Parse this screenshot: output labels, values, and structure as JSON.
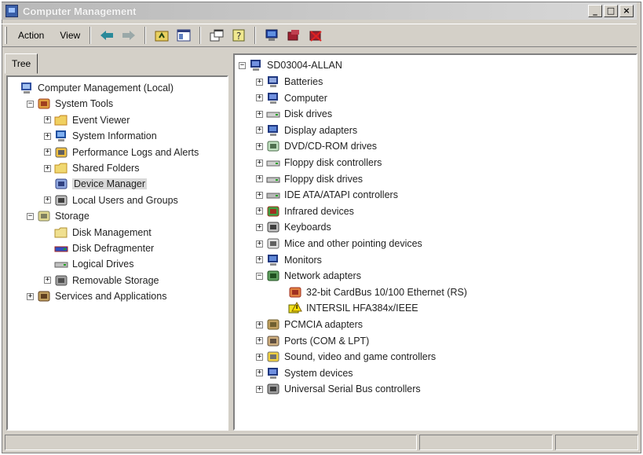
{
  "window": {
    "title": "Computer Management",
    "controls": [
      "_",
      "□",
      "×"
    ]
  },
  "toolbar": {
    "action_label": "Action",
    "view_label": "View"
  },
  "tabs": [
    {
      "label": "Tree"
    }
  ],
  "left_tree": [
    {
      "label": "Computer Management (Local)",
      "icon": "computer-management-icon",
      "expander": "",
      "selected": false
    },
    {
      "label": "System Tools",
      "icon": "system-tools-icon",
      "expander": "−",
      "selected": false
    },
    {
      "label": "Event Viewer",
      "icon": "event-viewer-icon",
      "expander": "+",
      "selected": false
    },
    {
      "label": "System Information",
      "icon": "system-information-icon",
      "expander": "+",
      "selected": false
    },
    {
      "label": "Performance Logs and Alerts",
      "icon": "performance-logs-icon",
      "expander": "+",
      "selected": false
    },
    {
      "label": "Shared Folders",
      "icon": "shared-folders-icon",
      "expander": "+",
      "selected": false
    },
    {
      "label": "Device Manager",
      "icon": "device-manager-icon",
      "expander": "",
      "selected": true
    },
    {
      "label": "Local Users and Groups",
      "icon": "local-users-icon",
      "expander": "+",
      "selected": false
    },
    {
      "label": "Storage",
      "icon": "storage-icon",
      "expander": "−",
      "selected": false
    },
    {
      "label": "Disk Management",
      "icon": "disk-management-icon",
      "expander": "",
      "selected": false
    },
    {
      "label": "Disk Defragmenter",
      "icon": "disk-defragmenter-icon",
      "expander": "",
      "selected": false
    },
    {
      "label": "Logical Drives",
      "icon": "logical-drives-icon",
      "expander": "",
      "selected": false
    },
    {
      "label": "Removable Storage",
      "icon": "removable-storage-icon",
      "expander": "+",
      "selected": false
    },
    {
      "label": "Services and Applications",
      "icon": "services-applications-icon",
      "expander": "+",
      "selected": false
    }
  ],
  "device_tree": {
    "root": {
      "label": "SD03004-ALLAN",
      "icon": "computer-icon"
    },
    "items": [
      {
        "label": "Batteries",
        "icon": "battery-icon",
        "expander": "+"
      },
      {
        "label": "Computer",
        "icon": "computer-icon",
        "expander": "+"
      },
      {
        "label": "Disk drives",
        "icon": "disk-drive-icon",
        "expander": "+"
      },
      {
        "label": "Display adapters",
        "icon": "display-adapter-icon",
        "expander": "+"
      },
      {
        "label": "DVD/CD-ROM drives",
        "icon": "cdrom-icon",
        "expander": "+"
      },
      {
        "label": "Floppy disk controllers",
        "icon": "floppy-controller-icon",
        "expander": "+"
      },
      {
        "label": "Floppy disk drives",
        "icon": "floppy-drive-icon",
        "expander": "+"
      },
      {
        "label": "IDE ATA/ATAPI controllers",
        "icon": "ide-controller-icon",
        "expander": "+"
      },
      {
        "label": "Infrared devices",
        "icon": "infrared-icon",
        "expander": "+"
      },
      {
        "label": "Keyboards",
        "icon": "keyboard-icon",
        "expander": "+"
      },
      {
        "label": "Mice and other pointing devices",
        "icon": "mouse-icon",
        "expander": "+"
      },
      {
        "label": "Monitors",
        "icon": "monitor-icon",
        "expander": "+"
      },
      {
        "label": "Network adapters",
        "icon": "network-adapter-icon",
        "expander": "−"
      },
      {
        "label": "32-bit CardBus 10/100 Ethernet (RS)",
        "icon": "network-card-icon",
        "expander": "",
        "child": true
      },
      {
        "label": "INTERSIL HFA384x/IEEE",
        "icon": "warning-device-icon",
        "expander": "",
        "child": true
      },
      {
        "label": "PCMCIA adapters",
        "icon": "pcmcia-icon",
        "expander": "+"
      },
      {
        "label": "Ports (COM & LPT)",
        "icon": "port-icon",
        "expander": "+"
      },
      {
        "label": "Sound, video and game controllers",
        "icon": "sound-icon",
        "expander": "+"
      },
      {
        "label": "System devices",
        "icon": "system-device-icon",
        "expander": "+"
      },
      {
        "label": "Universal Serial Bus controllers",
        "icon": "usb-icon",
        "expander": "+"
      }
    ]
  }
}
